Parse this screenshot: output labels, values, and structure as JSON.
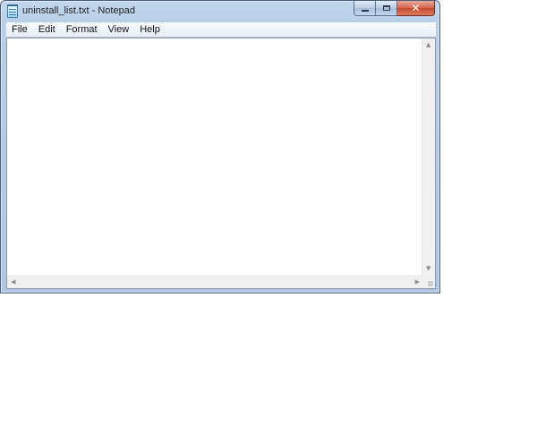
{
  "window": {
    "title": "uninstall_list.txt - Notepad",
    "minimize_glyph": "",
    "close_glyph": "✕"
  },
  "menu": {
    "items": [
      "File",
      "Edit",
      "Format",
      "View",
      "Help"
    ]
  },
  "editor": {
    "content": ""
  },
  "scrollbars": {
    "up_arrow": "▲",
    "down_arrow": "▼",
    "left_arrow": "◀",
    "right_arrow": "▶"
  },
  "icons": {
    "app": "notepad-icon",
    "minimize": "minimize-icon",
    "maximize": "maximize-icon",
    "close": "close-icon"
  },
  "colors": {
    "title_bar": "#b9cfe8",
    "close_button": "#c24a30",
    "editor_bg": "#ffffff"
  }
}
